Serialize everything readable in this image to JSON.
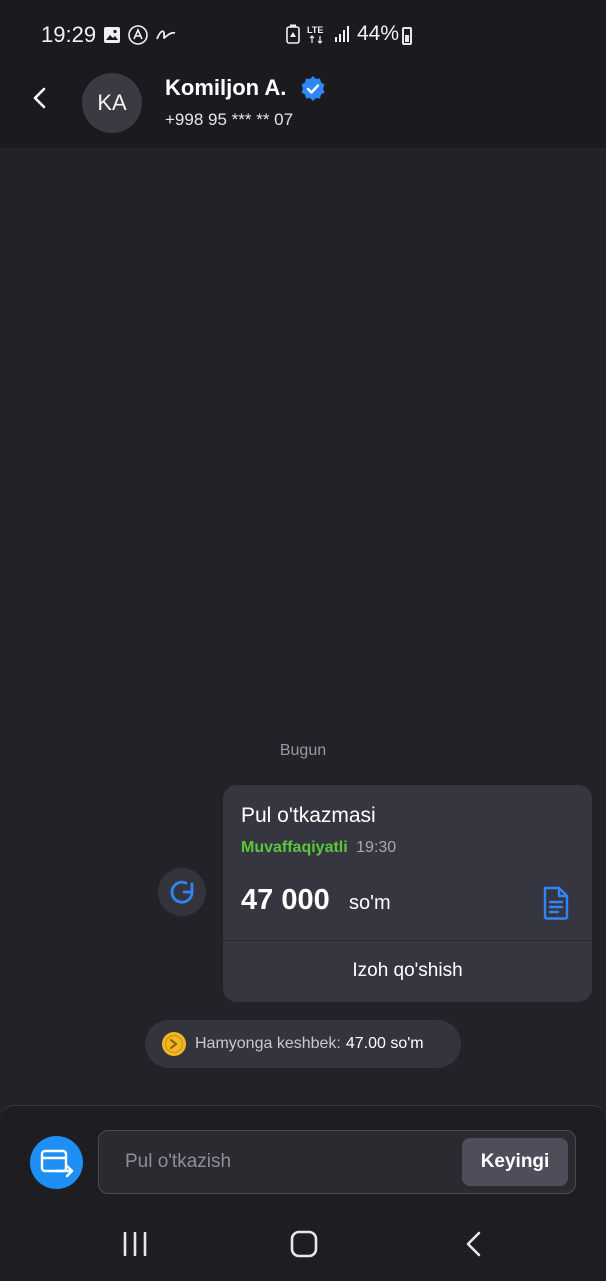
{
  "status_bar": {
    "time": "19:29",
    "network": "LTE",
    "battery": "44%",
    "left_icons": [
      "gallery-icon",
      "app-icon",
      "swipe-icon"
    ],
    "right_icons": [
      "battery-saver-icon",
      "lte-icon",
      "signal-icon",
      "battery-icon"
    ]
  },
  "header": {
    "back_icon": "chevron-left-icon",
    "avatar_initials": "KA",
    "name": "Komiljon A.",
    "verified_icon": "verified-badge-icon",
    "phone": "+998 95 *** ** 07"
  },
  "chat": {
    "day_label": "Bugun",
    "retry_icon": "refresh-icon",
    "transaction": {
      "title": "Pul o'tkazmasi",
      "status": "Muvaffaqiyatli",
      "time": "19:30",
      "amount": "47 000",
      "currency": "so'm",
      "receipt_icon": "document-icon",
      "comment_button": "Izoh qo'shish"
    },
    "cashback": {
      "icon": "coin-icon",
      "label": "Hamyonga keshbek:",
      "value": "47.00 so'm"
    }
  },
  "composer": {
    "transfer_icon": "card-transfer-icon",
    "placeholder": "Pul o'tkazish",
    "next_button": "Keyingi"
  },
  "navigation": {
    "recents_icon": "recents-icon",
    "home_icon": "home-icon",
    "back_icon": "back-icon"
  },
  "colors": {
    "background": "#222228",
    "bar": "#1b1b1f",
    "bubble": "#363640",
    "accent_blue": "#1e8ff5",
    "success_green": "#5ac83a"
  }
}
